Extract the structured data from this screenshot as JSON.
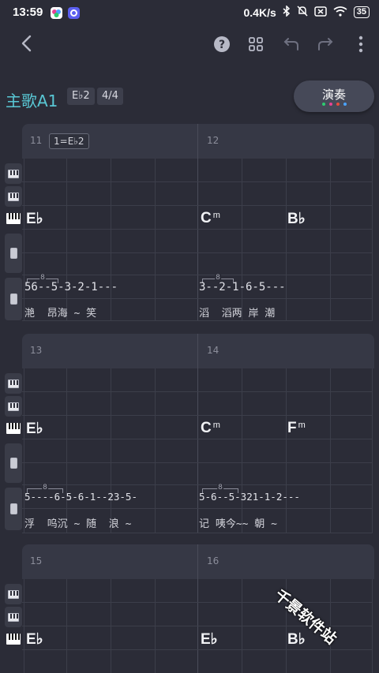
{
  "status": {
    "time": "13:59",
    "net_speed": "0.4K/s",
    "battery": "35"
  },
  "toolbar": {
    "icons": [
      "back-arrow-icon",
      "help-icon",
      "grid-icon",
      "undo-icon",
      "redo-icon",
      "more-vertical-icon"
    ]
  },
  "section": {
    "title": "主歌A1",
    "key": "E♭2",
    "time_sig": "4/4",
    "play_label": "演奏",
    "play_dot_colors": [
      "#2ecc71",
      "#e84393",
      "#e74c3c",
      "#4aa3ff"
    ]
  },
  "blocks": [
    {
      "bars": [
        "11",
        "12"
      ],
      "key_tag": "1=E♭2",
      "chords": [
        {
          "root": "E♭",
          "quality": ""
        },
        {
          "root": "C",
          "quality": "m"
        },
        {
          "root": "B♭",
          "quality": ""
        }
      ],
      "notes_left": "56--5-3-2-1---",
      "notes_right": "3--2-1-6-5---",
      "tuplet_left": "8",
      "tuplet_right": "8",
      "lyrics_left": "滟  昂海 ~ 笑",
      "lyrics_right": "滔  滔两 岸 潮"
    },
    {
      "bars": [
        "13",
        "14"
      ],
      "key_tag": "",
      "chords": [
        {
          "root": "E♭",
          "quality": ""
        },
        {
          "root": "C",
          "quality": "m"
        },
        {
          "root": "F",
          "quality": "m"
        }
      ],
      "notes_left": "5----6-5-6-1--23-5-",
      "notes_right": "5-6--5-321-1-2---",
      "tuplet_left": "8",
      "tuplet_right": "8",
      "lyrics_left": "浮  呜沉 ~ 随  浪 ~",
      "lyrics_right": "记 咦今~~ 朝 ~"
    },
    {
      "bars": [
        "15",
        "16"
      ],
      "key_tag": "",
      "chords": [
        {
          "root": "E♭",
          "quality": ""
        },
        {
          "root": "E♭",
          "quality": ""
        },
        {
          "root": "B♭",
          "quality": ""
        }
      ]
    }
  ],
  "watermark": "千景软件站"
}
